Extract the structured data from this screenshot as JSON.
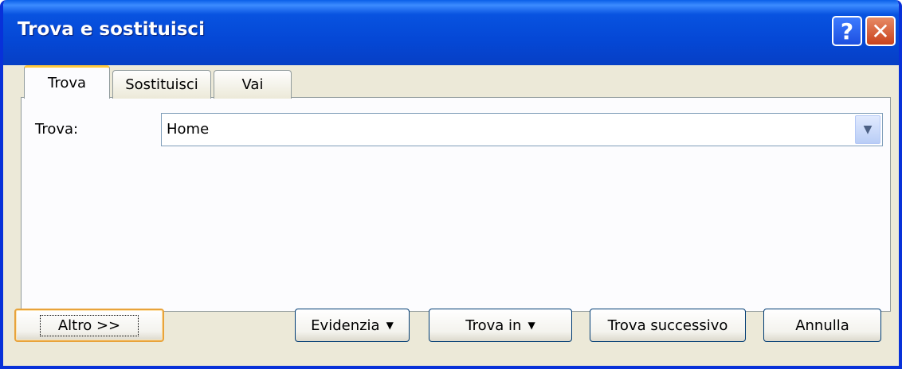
{
  "window": {
    "title": "Trova e sostituisci",
    "help_label": "?",
    "close_label": "✕"
  },
  "tabs": [
    {
      "label": "Trova",
      "active": true
    },
    {
      "label": "Sostituisci",
      "active": false
    },
    {
      "label": "Vai",
      "active": false
    }
  ],
  "find": {
    "label": "Trova:",
    "value": "Home"
  },
  "buttons": {
    "more": "Altro >>",
    "highlight": "Evidenzia",
    "find_in": "Trova in",
    "find_next": "Trova successivo",
    "cancel": "Annulla"
  },
  "icons": {
    "dropdown": "chevron-down-icon",
    "menu_caret": "caret-down-icon"
  },
  "colors": {
    "titlebar": "#0548d6",
    "face": "#ece9d8",
    "active_tab_accent": "#ffc83c",
    "close_button": "#c9421c"
  }
}
